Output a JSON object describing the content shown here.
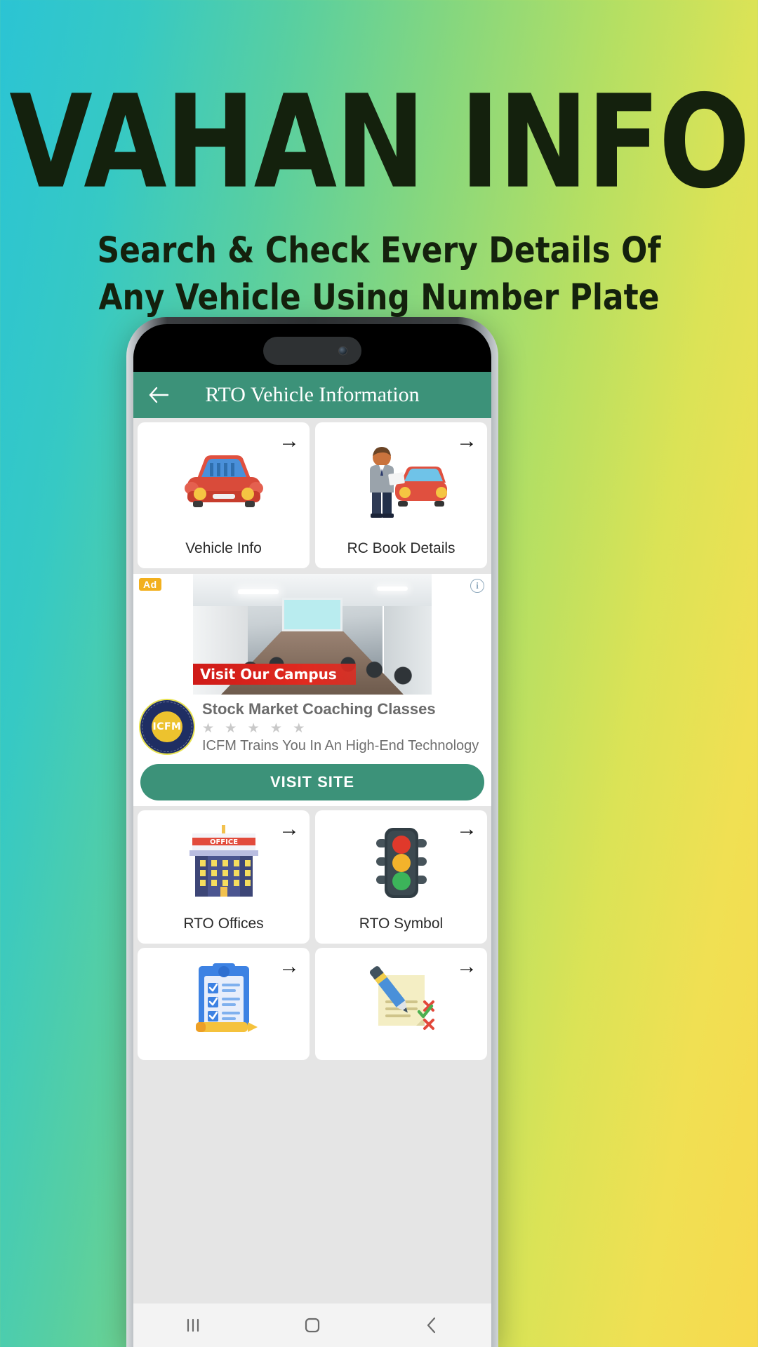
{
  "promo": {
    "title": "VAHAN INFO",
    "subtitle_line1": "Search & Check Every Details Of",
    "subtitle_line2": "Any Vehicle Using Number Plate",
    "background_colors": [
      "#2bc4d4",
      "#86d77e",
      "#f7d94e"
    ]
  },
  "app": {
    "appbar": {
      "back_icon": "back-arrow-icon",
      "title": "RTO Vehicle Information",
      "bg_color": "#3c9279",
      "title_color": "#ffffff"
    },
    "tiles": [
      {
        "label": "Vehicle Info",
        "icon": "car-front-icon",
        "arrow": "→"
      },
      {
        "label": "RC Book Details",
        "icon": "person-with-car-icon",
        "arrow": "→"
      },
      {
        "label": "RTO Offices",
        "icon": "office-building-icon",
        "arrow": "→"
      },
      {
        "label": "RTO Symbol",
        "icon": "traffic-light-icon",
        "arrow": "→"
      },
      {
        "label": "",
        "icon": "checklist-icon",
        "arrow": "→"
      },
      {
        "label": "",
        "icon": "note-pencil-icon",
        "arrow": "→"
      }
    ],
    "ad": {
      "badge": "Ad",
      "info_icon": "info-icon",
      "banner_text": "Visit Our Campus",
      "logo_text": "ICFM",
      "headline": "Stock Market Coaching Classes",
      "stars": "★ ★ ★ ★ ★",
      "rating": 5,
      "description": "ICFM Trains You In An High-End Technology",
      "cta_label": "VISIT SITE",
      "cta_color": "#3c9279"
    },
    "navbar": {
      "recents_icon": "recents-icon",
      "home_icon": "home-icon",
      "back_icon": "back-chevron-icon"
    }
  }
}
